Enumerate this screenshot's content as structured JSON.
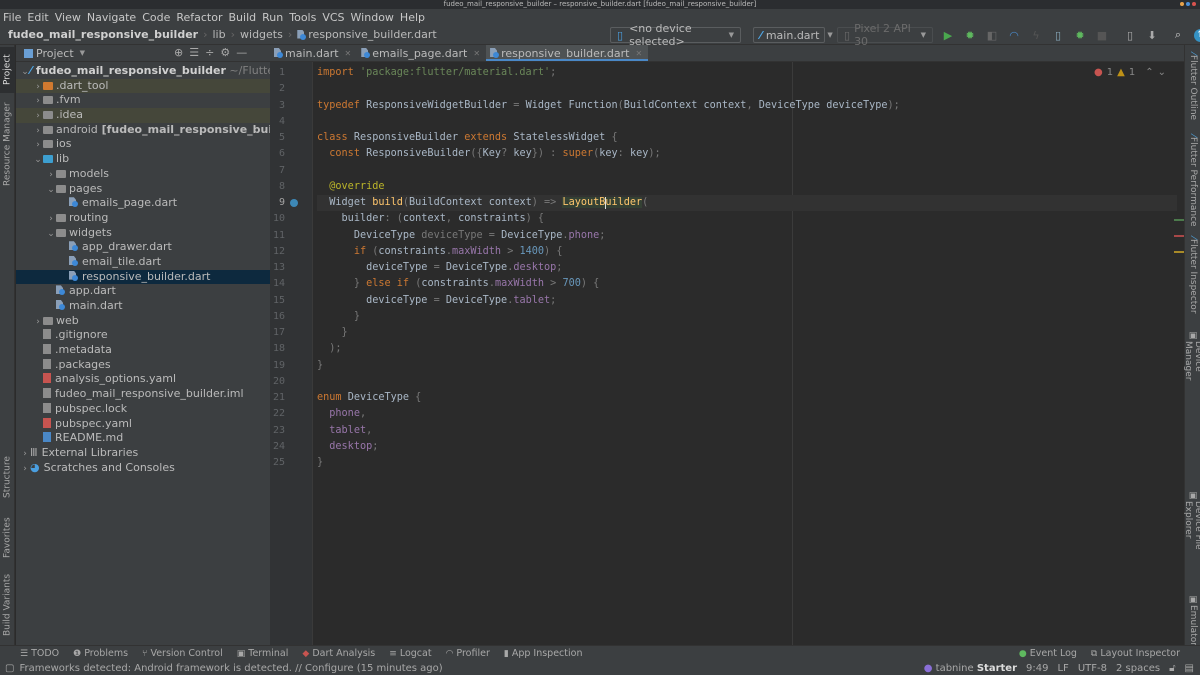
{
  "window": {
    "title": "fudeo_mail_responsive_builder – responsive_builder.dart [fudeo_mail_responsive_builder]"
  },
  "menu": [
    "File",
    "Edit",
    "View",
    "Navigate",
    "Code",
    "Refactor",
    "Build",
    "Run",
    "Tools",
    "VCS",
    "Window",
    "Help"
  ],
  "breadcrumb": [
    "fudeo_mail_responsive_builder",
    "lib",
    "widgets",
    "responsive_builder.dart"
  ],
  "toolbar": {
    "device_selector": "<no device selected>",
    "run_config": "main.dart",
    "emulator": "Pixel 2 API 30"
  },
  "project_panel": {
    "title": "Project",
    "tree": [
      {
        "label": "fudeo_mail_responsive_builder",
        "suffix": "~/FlutterProjects",
        "depth": 0,
        "type": "root",
        "expanded": true
      },
      {
        "label": ".dart_tool",
        "depth": 1,
        "type": "folder-excluded",
        "expanded": false
      },
      {
        "label": ".fvm",
        "depth": 1,
        "type": "folder",
        "expanded": false
      },
      {
        "label": ".idea",
        "depth": 1,
        "type": "folder-config",
        "expanded": false
      },
      {
        "label": "android",
        "suffix": "[fudeo_mail_responsive_builder_andro",
        "depth": 1,
        "type": "folder-module",
        "expanded": false
      },
      {
        "label": "ios",
        "depth": 1,
        "type": "folder-module",
        "expanded": false
      },
      {
        "label": "lib",
        "depth": 1,
        "type": "folder-source",
        "expanded": true
      },
      {
        "label": "models",
        "depth": 2,
        "type": "package",
        "expanded": false
      },
      {
        "label": "pages",
        "depth": 2,
        "type": "package",
        "expanded": true
      },
      {
        "label": "emails_page.dart",
        "depth": 3,
        "type": "dart"
      },
      {
        "label": "routing",
        "depth": 2,
        "type": "package",
        "expanded": false
      },
      {
        "label": "widgets",
        "depth": 2,
        "type": "package",
        "expanded": true
      },
      {
        "label": "app_drawer.dart",
        "depth": 3,
        "type": "dart"
      },
      {
        "label": "email_tile.dart",
        "depth": 3,
        "type": "dart"
      },
      {
        "label": "responsive_builder.dart",
        "depth": 3,
        "type": "dart",
        "selected": true
      },
      {
        "label": "app.dart",
        "depth": 2,
        "type": "dart"
      },
      {
        "label": "main.dart",
        "depth": 2,
        "type": "dart"
      },
      {
        "label": "web",
        "depth": 1,
        "type": "folder-module",
        "expanded": false
      },
      {
        "label": ".gitignore",
        "depth": 1,
        "type": "file-ignore"
      },
      {
        "label": ".metadata",
        "depth": 1,
        "type": "file"
      },
      {
        "label": ".packages",
        "depth": 1,
        "type": "file"
      },
      {
        "label": "analysis_options.yaml",
        "depth": 1,
        "type": "yaml"
      },
      {
        "label": "fudeo_mail_responsive_builder.iml",
        "depth": 1,
        "type": "iml"
      },
      {
        "label": "pubspec.lock",
        "depth": 1,
        "type": "file"
      },
      {
        "label": "pubspec.yaml",
        "depth": 1,
        "type": "yaml"
      },
      {
        "label": "README.md",
        "depth": 1,
        "type": "markdown"
      },
      {
        "label": "External Libraries",
        "depth": 0,
        "type": "libraries",
        "expanded": false
      },
      {
        "label": "Scratches and Consoles",
        "depth": 0,
        "type": "scratches",
        "expanded": false
      }
    ]
  },
  "editor_tabs": [
    {
      "label": "main.dart",
      "active": false
    },
    {
      "label": "emails_page.dart",
      "active": false
    },
    {
      "label": "responsive_builder.dart",
      "active": true
    }
  ],
  "editor": {
    "inspections": {
      "errors": "1",
      "warnings": "1"
    },
    "current_line": 9,
    "lines": [
      "import 'package:flutter/material.dart';",
      "",
      "typedef ResponsiveWidgetBuilder = Widget Function(BuildContext context, DeviceType deviceType);",
      "",
      "class ResponsiveBuilder extends StatelessWidget {",
      "  const ResponsiveBuilder({Key? key}) : super(key: key);",
      "",
      "  @override",
      "  Widget build(BuildContext context) => LayoutBuilder(",
      "    builder: (context, constraints) {",
      "      DeviceType deviceType = DeviceType.phone;",
      "      if (constraints.maxWidth > 1400) {",
      "        deviceType = DeviceType.desktop;",
      "      } else if (constraints.maxWidth > 700) {",
      "        deviceType = DeviceType.tablet;",
      "      }",
      "    }",
      "  );",
      "}",
      "",
      "enum DeviceType {",
      "  phone,",
      "  tablet,",
      "  desktop;",
      "}"
    ]
  },
  "left_tool_windows": [
    "Project",
    "Resource Manager",
    "Structure",
    "Favorites",
    "Build Variants"
  ],
  "right_tool_windows": [
    "Flutter Outline",
    "Flutter Performance",
    "Flutter Inspector",
    "Device Manager",
    "Device File Explorer",
    "Emulator"
  ],
  "bottom_tools": [
    "TODO",
    "Problems",
    "Version Control",
    "Terminal",
    "Dart Analysis",
    "Logcat",
    "Profiler",
    "App Inspection"
  ],
  "bottom_right_tools": [
    "Event Log",
    "Layout Inspector"
  ],
  "status": {
    "message": "Frameworks detected: Android framework is detected. // Configure (15 minutes ago)",
    "plugin": "tabnine",
    "plugin_tier": "Starter",
    "cursor": "9:49",
    "line_sep": "LF",
    "encoding": "UTF-8",
    "indent": "2 spaces"
  }
}
